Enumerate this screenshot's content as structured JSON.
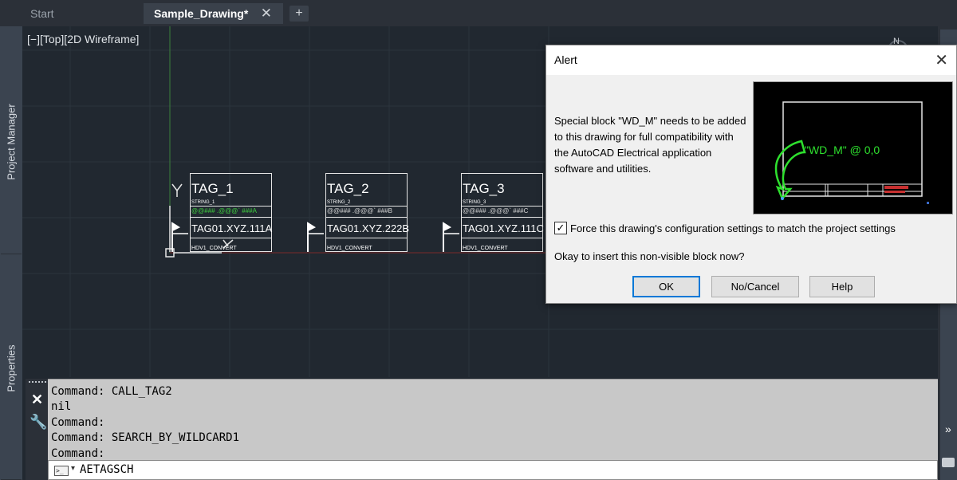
{
  "tabs": {
    "start": "Start",
    "active": "Sample_Drawing*",
    "close_glyph": "✕",
    "add_glyph": "+"
  },
  "palettes": {
    "project_manager": "Project Manager",
    "properties": "Properties"
  },
  "viewport": {
    "label": "[−][Top][2D Wireframe]",
    "compass_north": "N"
  },
  "tags": [
    {
      "name": "TAG_1",
      "string": "STRING_1",
      "pattern": "@@### .@@@` ###A",
      "pattern_color": "#3ecf3e",
      "code": "TAG01.XYZ.111A",
      "hdv": "HDV1_CONVERT"
    },
    {
      "name": "TAG_2",
      "string": "STRING_2",
      "pattern": "@@### .@@@` ###B",
      "pattern_color": "#d8d8d8",
      "code": "TAG01.XYZ.222B",
      "hdv": "HDV1_CONVERT"
    },
    {
      "name": "TAG_3",
      "string": "STRING_3",
      "pattern": "@@### .@@@` ###C",
      "pattern_color": "#d8d8d8",
      "code": "TAG01.XYZ.111C",
      "hdv": "HDV1_CONVERT"
    }
  ],
  "command": {
    "history": [
      "Command: CALL_TAG2",
      "nil",
      "Command:",
      "Command: SEARCH_BY_WILDCARD1",
      "Command:"
    ],
    "input": "AETAGSCH",
    "prompt_icon": ">_",
    "close_glyph": "✕",
    "customize_glyph": "🔧"
  },
  "dialog": {
    "title": "Alert",
    "close_glyph": "✕",
    "message": "Special block \"WD_M\" needs to be added to this drawing for full compatibility with the AutoCAD Electrical application software and utilities.",
    "preview_label": "\"WD_M\" @ 0,0",
    "checkbox_label": "Force this drawing's configuration settings to match the project settings",
    "checkbox_checked": true,
    "checkbox_glyph": "✓",
    "question": "Okay to insert this non-visible block now?",
    "buttons": {
      "ok": "OK",
      "no_cancel": "No/Cancel",
      "help": "Help"
    }
  },
  "right_strip": {
    "chevron": "»"
  },
  "colors": {
    "canvas_bg": "#212830",
    "dialog_bg": "#f0f0f0",
    "accent_green": "#3ecf3e",
    "ok_focus": "#0078d7"
  }
}
